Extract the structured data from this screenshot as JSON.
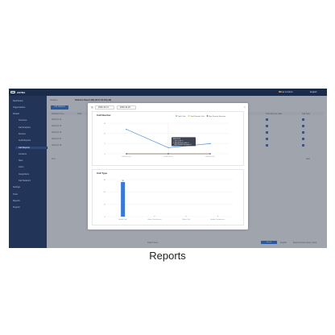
{
  "app": {
    "logo": "ASTRA",
    "page_title": "Statistics Report (IM) (30.07.XX.XX) (A8)"
  },
  "topbar": {
    "user": "Hai & Admin",
    "lang": "English"
  },
  "sidebar": {
    "items": [
      {
        "label": "Dashboard",
        "sub": false,
        "active": false
      },
      {
        "label": "Organizations",
        "sub": false,
        "active": false
      },
      {
        "label": "Default",
        "sub": false,
        "active": false
      },
      {
        "label": "Overview",
        "sub": true,
        "active": false
      },
      {
        "label": "Call Analytics",
        "sub": true,
        "active": false
      },
      {
        "label": "Devices",
        "sub": true,
        "active": false
      },
      {
        "label": "Audit Reports",
        "sub": true,
        "active": false
      },
      {
        "label": "Call Reports",
        "sub": true,
        "active": true
      },
      {
        "label": "Contacts",
        "sub": true,
        "active": false
      },
      {
        "label": "Sites",
        "sub": true,
        "active": false
      },
      {
        "label": "Users",
        "sub": true,
        "active": false
      },
      {
        "label": "Integrations",
        "sub": true,
        "active": false
      },
      {
        "label": "Call Statistics",
        "sub": true,
        "active": false
      },
      {
        "label": "Settings",
        "sub": false,
        "active": false
      },
      {
        "label": "Tools",
        "sub": false,
        "active": false
      },
      {
        "label": "Reports",
        "sub": false,
        "active": false
      },
      {
        "label": "Support",
        "sub": false,
        "active": false
      }
    ]
  },
  "background_table": {
    "breadcrumb": "Statistics",
    "button_label": "Call Statistics",
    "col_headers": [
      "Statistics Time",
      "Total",
      "Total Remote Calls",
      "Call Type"
    ],
    "rows": [
      "2020-10-14",
      "2020-10-15",
      "2020-10-16",
      "2020-10-17",
      "2020-10-18"
    ],
    "prev": "Prev",
    "next": "Next",
    "footer_left": "Total 5 items",
    "export": "Export",
    "footer_lang": "English",
    "footer_meta": "Export Format: Excel (.xlsx)"
  },
  "modal": {
    "date_from": "2020-10-14",
    "date_to": "2020-10-20",
    "close": "×"
  },
  "call_number_chart": {
    "title": "Call Number",
    "legend": [
      "Total Calls",
      "Total Remote Calls",
      "Max Remote Sessions"
    ],
    "tooltip": {
      "date": "2020-10-15",
      "lines": [
        "Total Calls: 3",
        "Total Remote Calls: 0",
        "Max Remote Sessions: 0"
      ]
    }
  },
  "call_type_chart": {
    "title": "Call Type",
    "bar_label": "28"
  },
  "chart_data": [
    {
      "type": "line",
      "title": "Call Number",
      "x": [
        "2020-10-14",
        "2020-10-15",
        "2020-10-16"
      ],
      "series": [
        {
          "name": "Total Calls",
          "values": [
            12,
            3,
            5
          ],
          "color": "#3a86e8"
        },
        {
          "name": "Total Remote Calls",
          "values": [
            0,
            0,
            0
          ],
          "color": "#f2b21b"
        },
        {
          "name": "Max Remote Sessions",
          "values": [
            0,
            0,
            0
          ],
          "color": "#2c3e66"
        }
      ],
      "ylim": [
        0,
        15
      ],
      "yticks": [
        0,
        5,
        10,
        15
      ],
      "grid": true,
      "legend": "top-right"
    },
    {
      "type": "bar",
      "title": "Call Type",
      "categories": [
        "Audio Call",
        "Video Conference",
        "Video Call",
        "Audio Conference"
      ],
      "values": [
        28,
        0,
        0,
        0
      ],
      "ylim": [
        0,
        30
      ],
      "yticks": [
        0,
        10,
        20,
        30
      ],
      "color": "#2f7be6",
      "grid": true
    }
  ],
  "caption": "Reports"
}
